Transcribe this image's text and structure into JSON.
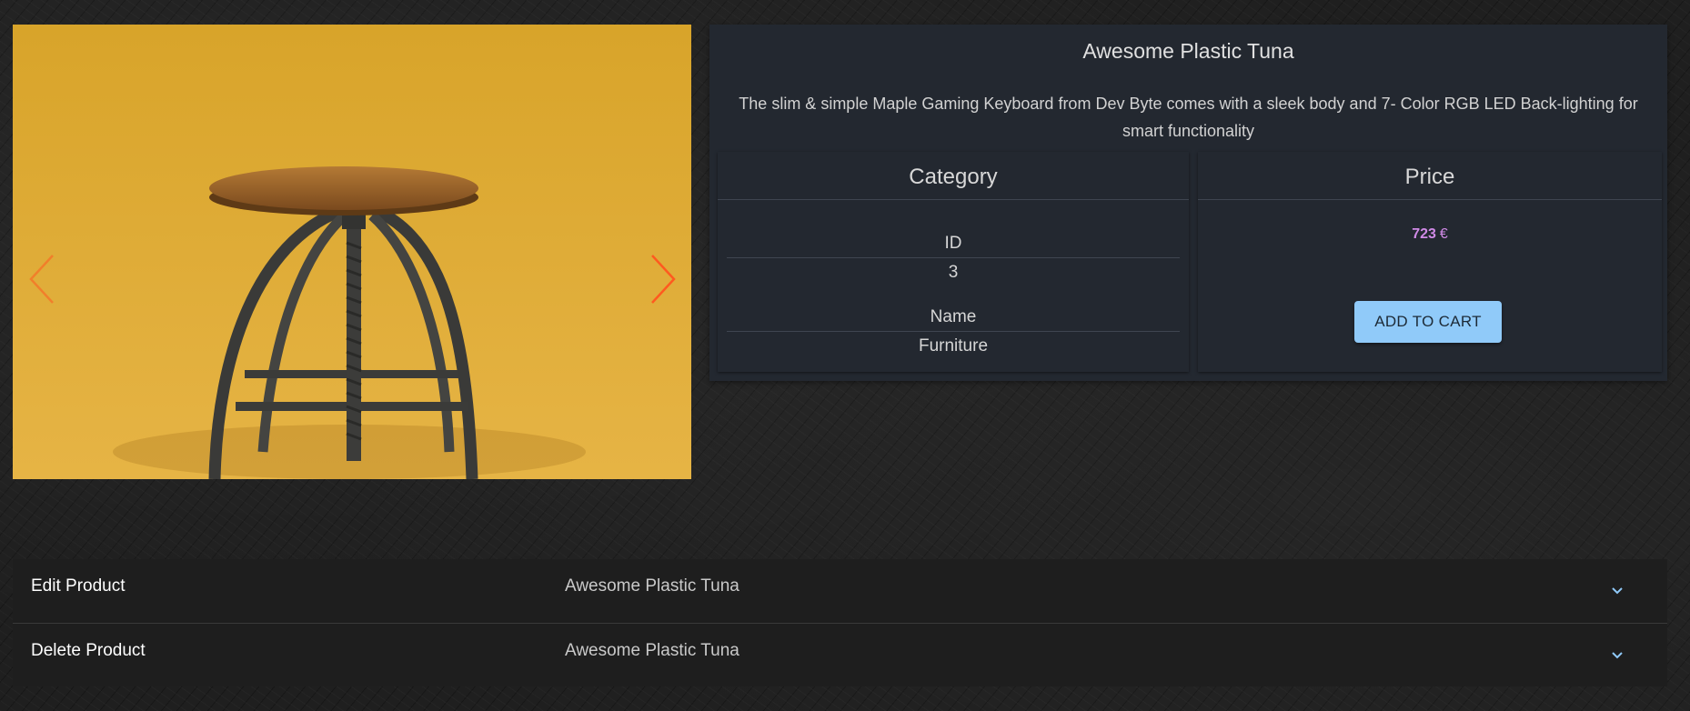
{
  "carousel": {
    "prev_icon": "chevron-left-icon",
    "next_icon": "chevron-right-icon",
    "slide_count": 3,
    "active_slide": 1,
    "arrow_color": "#ff5a1f"
  },
  "product": {
    "title": "Awesome Plastic Tuna",
    "description": "The slim & simple Maple Gaming Keyboard from Dev Byte comes with a sleek body and 7- Color RGB LED Back-lighting for smart functionality",
    "category_heading": "Category",
    "category_id_label": "ID",
    "category_id_value": "3",
    "category_name_label": "Name",
    "category_name_value": "Furniture",
    "price_heading": "Price",
    "price_value": "723",
    "price_currency": "€",
    "add_to_cart_label": "ADD TO CART"
  },
  "accordion": {
    "edit": {
      "title": "Edit Product",
      "subtitle": "Awesome Plastic Tuna",
      "icon": "chevron-down-icon"
    },
    "delete": {
      "title": "Delete Product",
      "subtitle": "Awesome Plastic Tuna",
      "icon": "chevron-down-icon"
    }
  },
  "colors": {
    "accent": "#90caf9",
    "price": "#d08ae6",
    "panel_bg": "#232830"
  }
}
